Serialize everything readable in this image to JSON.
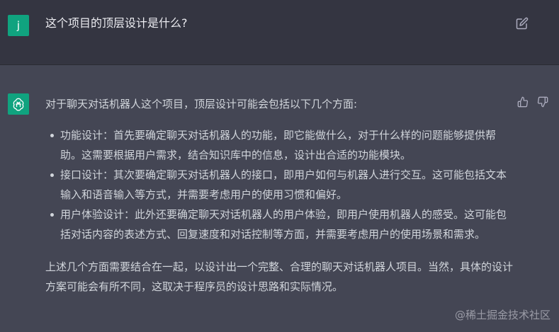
{
  "user_message": {
    "avatar_letter": "j",
    "text": "这个项目的顶层设计是什么?",
    "edit_icon": "edit-icon"
  },
  "assistant_message": {
    "intro": "对于聊天对话机器人这个项目，顶层设计可能会包括以下几个方面:",
    "items": [
      {
        "text": "功能设计：首先要确定聊天对话机器人的功能，即它能做什么，对于什么样的问题能够提供帮助。这需要根据用户需求，结合知识库中的信息，设计出合适的功能模块。"
      },
      {
        "text": "接口设计：其次要确定聊天对话机器人的接口，即用户如何与机器人进行交互。这可能包括文本输入和语音输入等方式，并需要考虑用户的使用习惯和偏好。"
      },
      {
        "text": "用户体验设计：此外还要确定聊天对话机器人的用户体验，即用户使用机器人的感受。这可能包括对话内容的表述方式、回复速度和对话控制等方面，并需要考虑用户的使用场景和需求。"
      }
    ],
    "conclusion": "上述几个方面需要结合在一起，以设计出一个完整、合理的聊天对话机器人项目。当然，具体的设计方案可能会有所不同，这取决于程序员的设计思路和实际情况。",
    "feedback_icons": [
      "thumbs-up-icon",
      "thumbs-down-icon"
    ]
  },
  "watermark": "@稀土掘金技术社区",
  "colors": {
    "user_bg": "#343541",
    "assistant_bg": "#444654",
    "accent": "#10a37f",
    "text": "#d1d5db"
  }
}
